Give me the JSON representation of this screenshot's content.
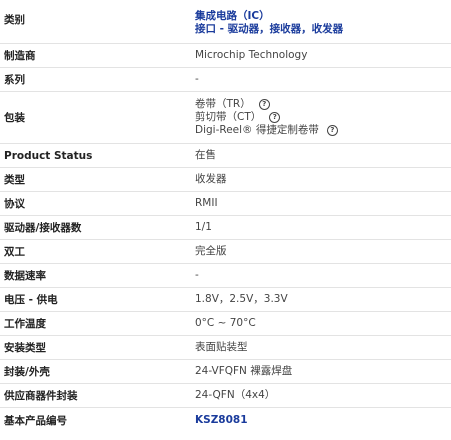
{
  "rows": [
    {
      "label": "类别",
      "values": [
        "集成电路（IC）",
        "接口 - 驱动器，接收器，收发器"
      ]
    },
    {
      "label": "制造商",
      "value": "Microchip Technology"
    },
    {
      "label": "系列",
      "value": "-"
    },
    {
      "label": "包装",
      "values": [
        "卷带（TR）",
        "剪切带（CT）",
        "Digi-Reel® 得捷定制卷带"
      ]
    },
    {
      "label": "Product Status",
      "value": "在售"
    },
    {
      "label": "类型",
      "value": "收发器"
    },
    {
      "label": "协议",
      "value": "RMII"
    },
    {
      "label": "驱动器/接收器数",
      "value": "1/1"
    },
    {
      "label": "双工",
      "value": "完全版"
    },
    {
      "label": "数据速率",
      "value": "-"
    },
    {
      "label": "电压 - 供电",
      "value": "1.8V，2.5V，3.3V"
    },
    {
      "label": "工作温度",
      "value": "0°C ~ 70°C"
    },
    {
      "label": "安装类型",
      "value": "表面贴装型"
    },
    {
      "label": "封装/外壳",
      "value": "24-VFQFN 裸露焊盘"
    },
    {
      "label": "供应商器件封装",
      "value": "24-QFN（4x4）"
    },
    {
      "label": "基本产品编号",
      "value": "KSZ8081"
    }
  ],
  "icons": {
    "help": "question-circle-icon",
    "help_glyph": "?"
  },
  "colors": {
    "link": "#1a3b9c",
    "divider": "#e3e3e3"
  }
}
